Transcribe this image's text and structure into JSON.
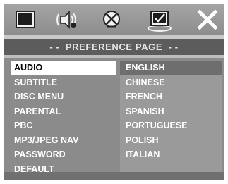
{
  "toolbar": {
    "icons": [
      {
        "name": "general-setup-icon"
      },
      {
        "name": "audio-setup-icon"
      },
      {
        "name": "video-setup-icon"
      },
      {
        "name": "preference-setup-icon"
      },
      {
        "name": "close-icon"
      }
    ],
    "close_glyph": "✕"
  },
  "page_title": "- -  PREFERENCE PAGE  - -",
  "menu": {
    "items": [
      {
        "label": "AUDIO",
        "selected": true
      },
      {
        "label": "SUBTITLE"
      },
      {
        "label": "DISC MENU"
      },
      {
        "label": "PARENTAL"
      },
      {
        "label": "PBC"
      },
      {
        "label": "MP3/JPEG NAV"
      },
      {
        "label": "PASSWORD"
      },
      {
        "label": "DEFAULT"
      }
    ]
  },
  "options": {
    "items": [
      {
        "label": "ENGLISH",
        "selected": true
      },
      {
        "label": "CHINESE"
      },
      {
        "label": "FRENCH"
      },
      {
        "label": "SPANISH"
      },
      {
        "label": "PORTUGUESE"
      },
      {
        "label": "POLISH"
      },
      {
        "label": "ITALIAN"
      }
    ]
  },
  "colors": {
    "panel": "#8b8b8b",
    "title_bar": "#5c5c5c",
    "selected_menu_bg": "#ffffff",
    "selected_option_bg": "#6e6e6e",
    "text": "#ffffff"
  }
}
